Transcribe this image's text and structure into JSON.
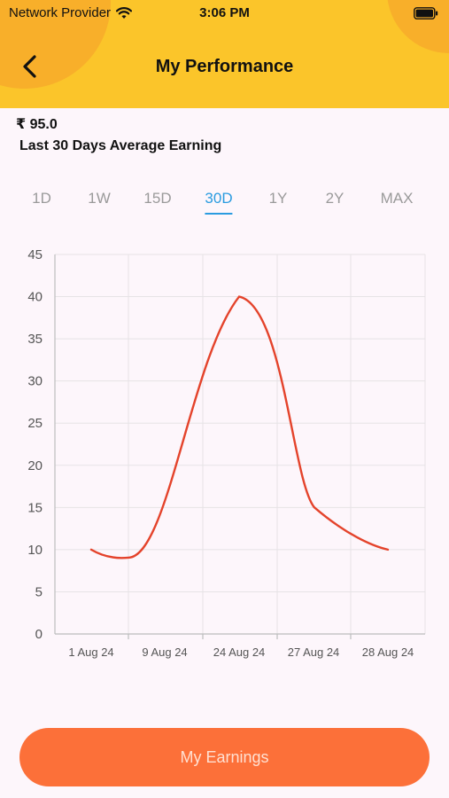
{
  "status_bar": {
    "carrier": "Network Provider",
    "time": "3:06 PM",
    "wifi_icon": "wifi-icon",
    "battery_icon": "battery-icon"
  },
  "header": {
    "title": "My Performance",
    "back_icon": "chevron-left-icon",
    "background_color": "#fbc52a"
  },
  "summary": {
    "amount": "₹ 95.0",
    "label": "Last 30 Days Average Earning"
  },
  "tabs": [
    {
      "label": "1D",
      "active": false
    },
    {
      "label": "1W",
      "active": false
    },
    {
      "label": "15D",
      "active": false
    },
    {
      "label": "30D",
      "active": true
    },
    {
      "label": "1Y",
      "active": false
    },
    {
      "label": "2Y",
      "active": false
    },
    {
      "label": "MAX",
      "active": false
    }
  ],
  "chart_data": {
    "type": "line",
    "categories": [
      "1 Aug 24",
      "9 Aug 24",
      "24 Aug 24",
      "27 Aug 24",
      "28 Aug 24"
    ],
    "series": [
      {
        "values": [
          10,
          10,
          40,
          15,
          10
        ],
        "color": "#e4432b"
      }
    ],
    "ylim": [
      0,
      45
    ],
    "yticks": [
      0,
      5,
      10,
      15,
      20,
      25,
      30,
      35,
      40,
      45
    ],
    "grid": true,
    "smooth": true,
    "legend": "none"
  },
  "actions": {
    "earnings_label": "My Earnings",
    "button_color": "#fc7039"
  }
}
